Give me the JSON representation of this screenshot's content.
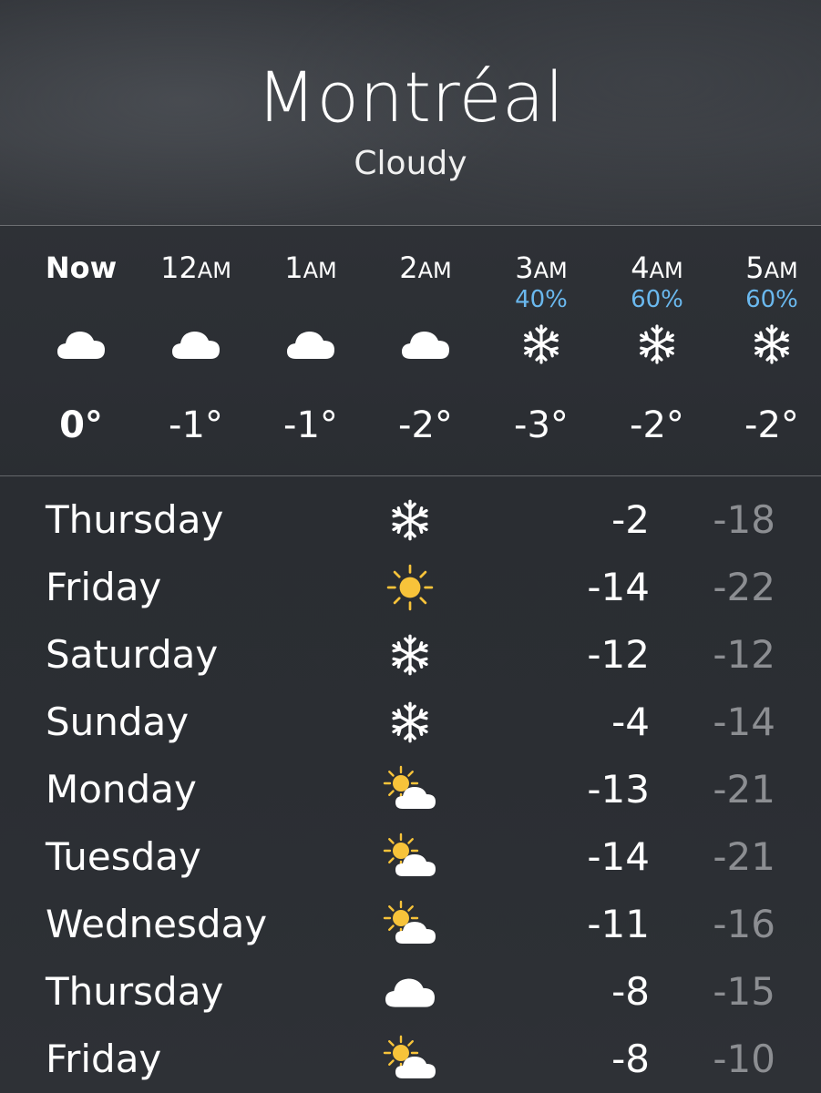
{
  "header": {
    "city": "Montréal",
    "condition": "Cloudy"
  },
  "hourly": [
    {
      "hour": "Now",
      "suffix": "",
      "chance": "",
      "icon": "cloud-icon",
      "temp": "0°"
    },
    {
      "hour": "12",
      "suffix": "AM",
      "chance": "",
      "icon": "cloud-icon",
      "temp": "-1°"
    },
    {
      "hour": "1",
      "suffix": "AM",
      "chance": "",
      "icon": "cloud-icon",
      "temp": "-1°"
    },
    {
      "hour": "2",
      "suffix": "AM",
      "chance": "",
      "icon": "cloud-icon",
      "temp": "-2°"
    },
    {
      "hour": "3",
      "suffix": "AM",
      "chance": "40%",
      "icon": "snowflake-icon",
      "temp": "-3°"
    },
    {
      "hour": "4",
      "suffix": "AM",
      "chance": "60%",
      "icon": "snowflake-icon",
      "temp": "-2°"
    },
    {
      "hour": "5",
      "suffix": "AM",
      "chance": "60%",
      "icon": "snowflake-icon",
      "temp": "-2°"
    }
  ],
  "daily": [
    {
      "day": "Thursday",
      "icon": "snowflake-icon",
      "high": "-2",
      "low": "-18"
    },
    {
      "day": "Friday",
      "icon": "sun-icon",
      "high": "-14",
      "low": "-22"
    },
    {
      "day": "Saturday",
      "icon": "snowflake-icon",
      "high": "-12",
      "low": "-12"
    },
    {
      "day": "Sunday",
      "icon": "snowflake-icon",
      "high": "-4",
      "low": "-14"
    },
    {
      "day": "Monday",
      "icon": "partly-sunny-icon",
      "high": "-13",
      "low": "-21"
    },
    {
      "day": "Tuesday",
      "icon": "partly-sunny-icon",
      "high": "-14",
      "low": "-21"
    },
    {
      "day": "Wednesday",
      "icon": "partly-sunny-icon",
      "high": "-11",
      "low": "-16"
    },
    {
      "day": "Thursday",
      "icon": "cloud-icon",
      "high": "-8",
      "low": "-15"
    },
    {
      "day": "Friday",
      "icon": "partly-sunny-icon",
      "high": "-8",
      "low": "-10"
    }
  ],
  "colors": {
    "precip_chance": "#6ab8ee",
    "sun": "#f7c33a",
    "low_temp": "#8c8e92"
  }
}
